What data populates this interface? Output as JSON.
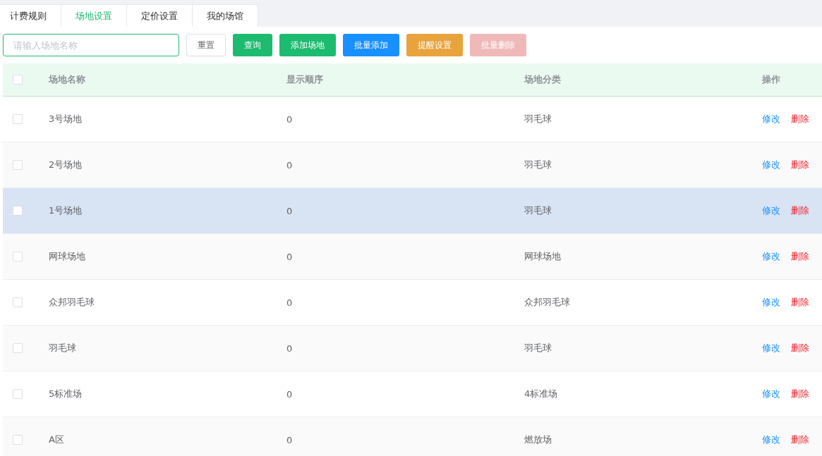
{
  "tabs": [
    {
      "label": "计费规则",
      "selected": false
    },
    {
      "label": "场地设置",
      "selected": true
    },
    {
      "label": "定价设置",
      "selected": false
    },
    {
      "label": "我的场馆",
      "selected": false
    }
  ],
  "search": {
    "placeholder": "请输入场地名称"
  },
  "buttons": [
    {
      "label": "重置",
      "kind": "default",
      "disabled": false
    },
    {
      "label": "查询",
      "kind": "success",
      "disabled": false
    },
    {
      "label": "添加场地",
      "kind": "success",
      "disabled": false
    },
    {
      "label": "批量添加",
      "kind": "primary",
      "disabled": false
    },
    {
      "label": "提醒设置",
      "kind": "warning",
      "disabled": false
    },
    {
      "label": "批量删除",
      "kind": "danger",
      "disabled": true
    }
  ],
  "table": {
    "select_all_checked": false,
    "columns": [
      "场地名称",
      "显示顺序",
      "场地分类",
      "操作"
    ],
    "rows": [
      {
        "checked": false,
        "hovered": false,
        "name": "3号场地",
        "order": "0",
        "category": "羽毛球",
        "actions": [
          "修改",
          "删除"
        ]
      },
      {
        "checked": false,
        "hovered": false,
        "name": "2号场地",
        "order": "0",
        "category": "羽毛球",
        "actions": [
          "修改",
          "删除"
        ]
      },
      {
        "checked": false,
        "hovered": true,
        "name": "1号场地",
        "order": "0",
        "category": "羽毛球",
        "actions": [
          "修改",
          "删除"
        ]
      },
      {
        "checked": false,
        "hovered": false,
        "name": "网球场地",
        "order": "0",
        "category": "网球场地",
        "actions": [
          "修改",
          "删除"
        ]
      },
      {
        "checked": false,
        "hovered": false,
        "name": "众邦羽毛球",
        "order": "0",
        "category": "众邦羽毛球",
        "actions": [
          "修改",
          "删除"
        ]
      },
      {
        "checked": false,
        "hovered": false,
        "name": "羽毛球",
        "order": "0",
        "category": "羽毛球",
        "actions": [
          "修改",
          "删除"
        ]
      },
      {
        "checked": false,
        "hovered": false,
        "name": "5标准场",
        "order": "0",
        "category": "4标准场",
        "actions": [
          "修改",
          "删除"
        ]
      },
      {
        "checked": false,
        "hovered": false,
        "name": "A区",
        "order": "0",
        "category": "燃放场",
        "actions": [
          "修改",
          "删除"
        ]
      }
    ]
  }
}
